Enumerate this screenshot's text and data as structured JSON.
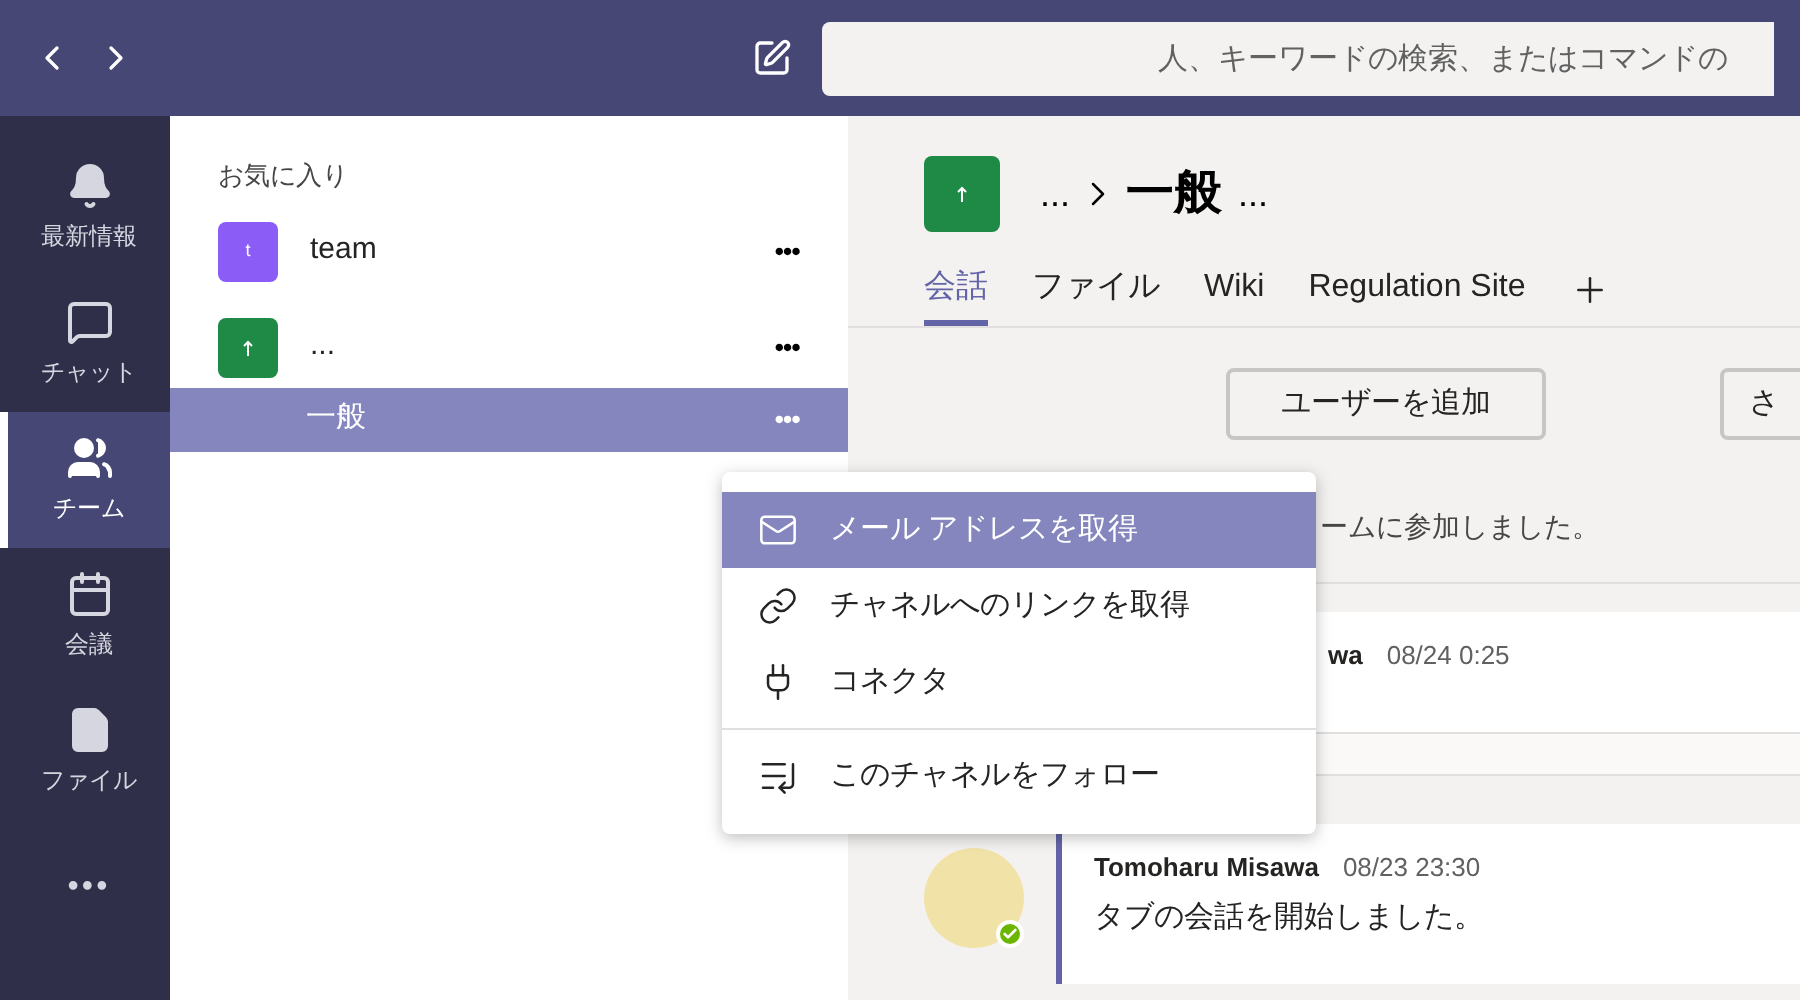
{
  "search": {
    "placeholder": "人、キーワードの検索、またはコマンドの"
  },
  "rail": [
    {
      "label": "最新情報",
      "kind": "bell",
      "selected": false
    },
    {
      "label": "チャット",
      "kind": "chat",
      "selected": false
    },
    {
      "label": "チーム",
      "kind": "teams",
      "selected": true
    },
    {
      "label": "会議",
      "kind": "calendar",
      "selected": false
    },
    {
      "label": "ファイル",
      "kind": "file",
      "selected": false
    },
    {
      "label": "•••",
      "kind": "more",
      "selected": false
    }
  ],
  "team_list": {
    "header": "お気に入り",
    "teams": [
      {
        "name": "team",
        "avatar": "t",
        "color": "#8b5cf6",
        "more": "•••"
      },
      {
        "name": "...",
        "color": "#1e8a45",
        "more": "•••",
        "children": [
          {
            "name": "一般",
            "selected": true,
            "more": "•••"
          }
        ]
      }
    ]
  },
  "channel_header": {
    "team": "...",
    "channel": "一般",
    "more": "..."
  },
  "tabs": [
    {
      "label": "会話",
      "selected": true
    },
    {
      "label": "ファイル",
      "selected": false
    },
    {
      "label": "Wiki",
      "selected": false
    },
    {
      "label": "Regulation Site",
      "selected": false
    }
  ],
  "buttons": [
    "ユーザーを追加",
    "さ"
  ],
  "feed": [
    {
      "kind": "event",
      "text": "ームに参加しました。"
    },
    {
      "kind": "message",
      "author": "wa",
      "time": "08/24 0:25"
    },
    {
      "kind": "reply"
    },
    {
      "kind": "thread",
      "author": "Tomoharu Misawa",
      "time": "08/23 23:30",
      "text": "タブの会話を開始しました。"
    }
  ],
  "context_menu": [
    {
      "kind": "item",
      "label": "メール アドレスを取得",
      "selected": true
    },
    {
      "kind": "item",
      "label": "チャネルへのリンクを取得",
      "selected": false
    },
    {
      "kind": "item",
      "label": "コネクタ",
      "selected": false
    },
    {
      "kind": "divider"
    },
    {
      "kind": "item",
      "label": "このチャネルをフォロー",
      "selected": false
    }
  ]
}
